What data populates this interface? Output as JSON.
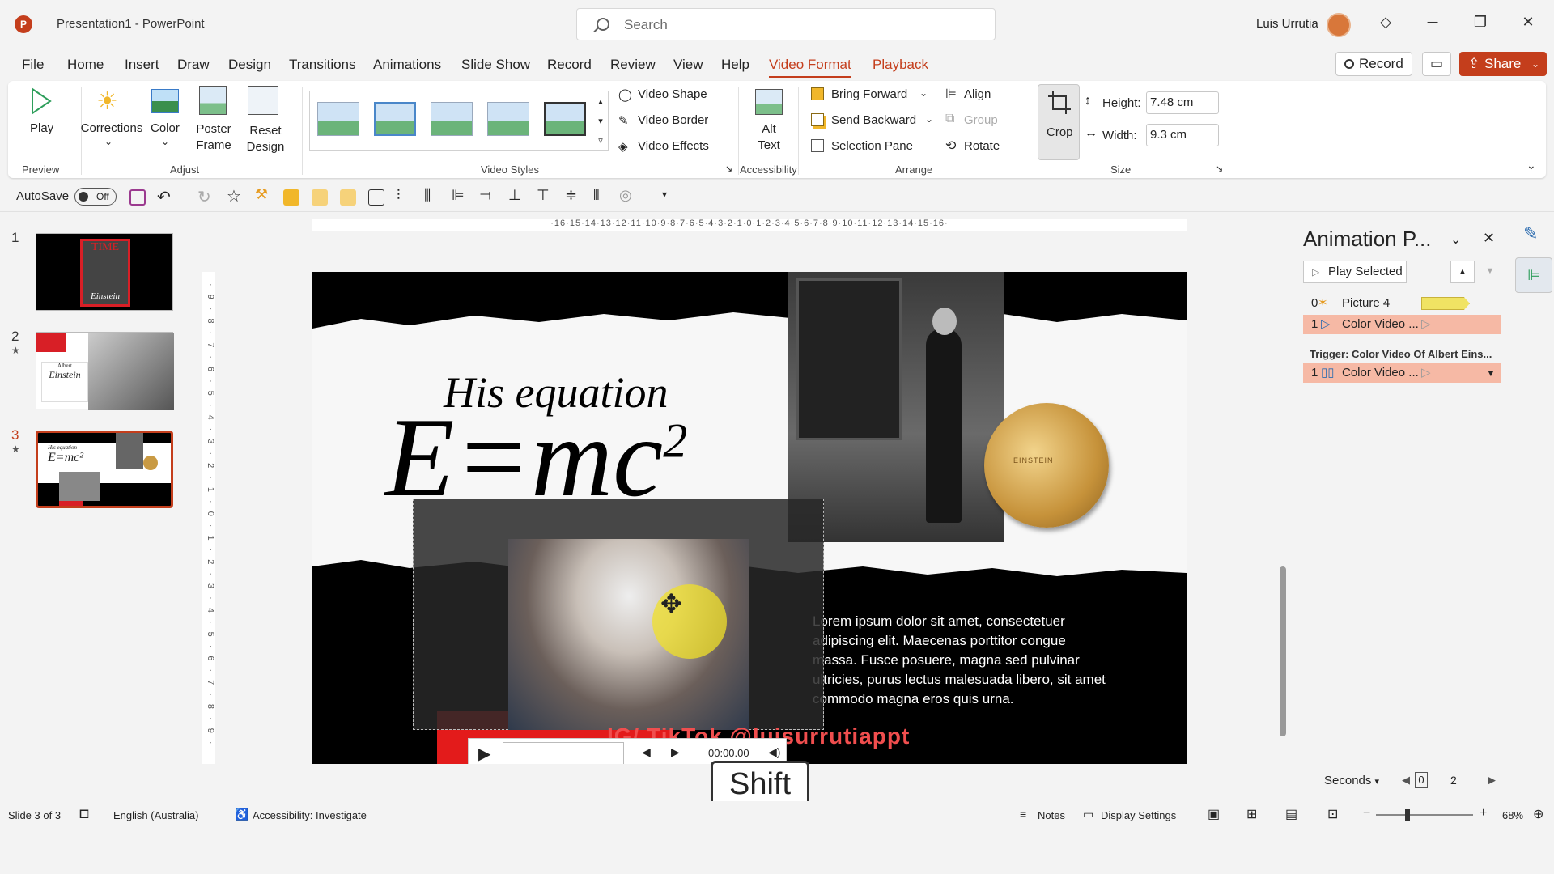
{
  "app": {
    "title": "Presentation1  -  PowerPoint",
    "logo": "P",
    "user": "Luis Urrutia"
  },
  "search": {
    "placeholder": "Search"
  },
  "window_controls": {
    "minimize": "─",
    "maximize": "❐",
    "close": "✕"
  },
  "menu": {
    "tabs": [
      "File",
      "Home",
      "Insert",
      "Draw",
      "Design",
      "Transitions",
      "Animations",
      "Slide Show",
      "Record",
      "Review",
      "View",
      "Help",
      "Video Format",
      "Playback"
    ],
    "active": "Video Format"
  },
  "header_buttons": {
    "record": "Record",
    "share": "Share"
  },
  "ribbon": {
    "preview": {
      "play": "Play",
      "group": "Preview"
    },
    "adjust": {
      "corrections": "Corrections",
      "color": "Color",
      "poster_frame": "Poster Frame",
      "reset_design": "Reset Design",
      "group": "Adjust"
    },
    "video_styles": {
      "group": "Video Styles",
      "video_shape": "Video Shape",
      "video_border": "Video Border",
      "video_effects": "Video Effects"
    },
    "accessibility": {
      "alt_text": "Alt Text",
      "group": "Accessibility"
    },
    "arrange": {
      "bring_forward": "Bring Forward",
      "send_backward": "Send Backward",
      "selection_pane": "Selection Pane",
      "align": "Align",
      "group_btn": "Group",
      "rotate": "Rotate",
      "group": "Arrange"
    },
    "size": {
      "crop": "Crop",
      "height_label": "Height:",
      "height": "7.48 cm",
      "width_label": "Width:",
      "width": "9.3 cm",
      "group": "Size"
    }
  },
  "qat": {
    "autosave": "AutoSave",
    "toggle": "Off"
  },
  "ruler": {
    "h": "·16·15·14·13·12·11·10·9·8·7·6·5·4·3·2·1·0·1·2·3·4·5·6·7·8·9·10·11·12·13·14·15·16·",
    "v": "·9·8·7·6·5·4·3·2·1·0·1·2·3·4·5·6·7·8·9·"
  },
  "slides": [
    {
      "num": "1"
    },
    {
      "num": "2",
      "star": "★"
    },
    {
      "num": "3",
      "star": "★"
    }
  ],
  "slide_thumbs": {
    "s1_title": "TIME",
    "s1_name": "Einstein",
    "s2_small": "Albert",
    "s2_name": "Einstein",
    "s3_title": "His equation",
    "s3_eq": "E=mc²"
  },
  "slide": {
    "heading": "His equation",
    "equation": "E=mc",
    "sup": "2",
    "body": "Lorem ipsum dolor sit amet, consectetuer adipiscing elit. Maecenas porttitor congue massa. Fusce posuere, magna sed pulvinar ultricies, purus lectus malesuada libero, sit amet commodo magna eros quis urna.",
    "watermark": "IG/ TikTok @luisurrutiappt",
    "video_time": "00:00.00",
    "medal_text": "EINSTEIN"
  },
  "shift_overlay": "Shift",
  "anim_pane": {
    "title": "Animation P...",
    "play_selected": "Play Selected",
    "items": [
      {
        "num": "0",
        "name": "Picture 4"
      },
      {
        "num": "1",
        "name": "Color Video ..."
      }
    ],
    "trigger": "Trigger: Color Video Of Albert Eins...",
    "trigger_items": [
      {
        "num": "1",
        "name": "Color Video ..."
      }
    ],
    "seconds": "Seconds",
    "time_start": "0",
    "time_end": "2"
  },
  "status": {
    "slide": "Slide 3 of 3",
    "language": "English (Australia)",
    "accessibility": "Accessibility: Investigate",
    "notes": "Notes",
    "display": "Display Settings",
    "zoom": "68%"
  },
  "colors": {
    "accent": "#c43e1c",
    "anim_highlight": "#f6b9a5",
    "bar_yellow": "#f0e363"
  }
}
